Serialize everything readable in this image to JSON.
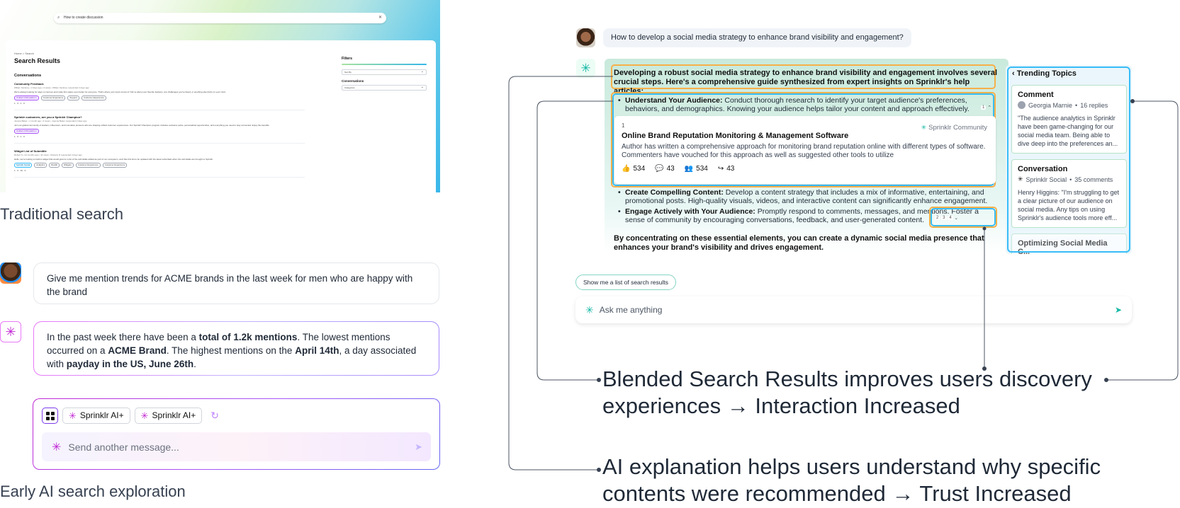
{
  "traditional": {
    "search_value": "How to create discussion",
    "breadcrumb": "Home > Search",
    "title": "Search Results",
    "section": "Conversations",
    "items": [
      {
        "title": "Community Feedback",
        "meta": "Willam Fackney • 2 days ago • 3 views • Willam Fackney responded 2 days ago",
        "desc": "We're always looking for ways to improve and make this space even better for everyone. That's where your input comes in! Tell us about your favorite features, any challenges you've faced, or anything else that's on your mind.",
        "tags": [
          "Unified CXM platform",
          "Customer Experience",
          "Support",
          "Customer Experience"
        ],
        "stats": "1 · 0 · 1 · 0"
      },
      {
        "title": "Sprinklr customers, are you a Sprinklr Champion?",
        "meta": "Joanna Baker • 1 month ago • 3 views • Joanna Baker responded 2 days ago",
        "desc": "Join our global community of leaders, influencers, and innovative pioneers who are shaping unified customer experiences. Our Sprinklr Champion program includes exclusive perks, personalized opportunities, and everything you need to stay connected. Enjoy the benefits.",
        "tags": [
          "Unified CXM platform"
        ],
        "stats": "1 · 0 · 1 · 0"
      },
      {
        "title": "Widget List of Submittle",
        "meta": "Robert S • 44 months ago • 44 views • Roberto R responded 3 days ago",
        "desc": "Hello, we're looking to build a widget that would grant to a list of the submittals added as part of our ecosystem, we'd like this list to be updated with the latest submittals when the submittals are brought to Sprinklr.",
        "tags": [
          "Sprinklr Social",
          "Analytics",
          "Reddit",
          "Widgets",
          "Customer Experience",
          "Customer Experience"
        ],
        "stats": "1 · 0 · 10 · 0"
      }
    ],
    "filters": {
      "title": "Filters",
      "select1": "Sort By",
      "title2": "Conversations",
      "select2": "Categories"
    },
    "caption": "Traditional search"
  },
  "early": {
    "user_message": "Give me mention trends for ACME brands in the last week for men who are happy with the brand",
    "ai_parts": {
      "p1": "In the past week there have been a ",
      "b1": "total of 1.2k mentions",
      "p2": ". The lowest mentions occurred on a ",
      "b2": "ACME Brand",
      "p3": ". The highest mentions on the ",
      "b3": "April 14th",
      "p4": ", a day associated with ",
      "b4": "payday in the US, June 26th",
      "p5": "."
    },
    "chips": [
      "Sprinklr AI+",
      "Sprinklr AI+"
    ],
    "input_placeholder": "Send another message...",
    "caption": "Early AI search exploration"
  },
  "blended": {
    "question": "How to develop a social media strategy to enhance brand visibility and engagement?",
    "intro": "Developing a robust social media strategy to enhance brand visibility and engagement involves several crucial steps. Here's a comprehensive guide synthesized from expert insights on Sprinklr's help articles:",
    "bullets": [
      {
        "bold": "Understand Your Audience:",
        "text": " Conduct thorough research to identify your target audience's preferences, behaviors, and demographics. Knowing your audience helps tailor your content and approach effectively."
      },
      {
        "bold": "Create Compelling Content:",
        "text": " Develop a content strategy that includes a mix of informative, entertaining, and promotional posts. High-quality visuals, videos, and interactive content can significantly enhance engagement."
      },
      {
        "bold": "Engage Actively with Your Audience:",
        "text": " Promptly respond to comments, messages, and mentions. Foster a sense of community by encouraging conversations, feedback, and user-generated content."
      }
    ],
    "bullet1_cite": "1",
    "bullet3_cites": [
      "2",
      "3",
      "4"
    ],
    "source": {
      "num": "1",
      "brand": "Sprinklr Community",
      "title": "Online Brand Reputation Monitoring & Management Software",
      "desc": "Author has written a comprehensive approach for monitoring brand reputation online with different types of software. Commenters have vouched for this approach as well as suggested other tools to utilize",
      "likes": "534",
      "comments": "43",
      "members": "534",
      "shares": "43"
    },
    "outro": "By concentrating on these essential elements, you can create a dynamic social media presence that enhances your brand's visibility and drives engagement.",
    "trending": {
      "title": "Trending Topics",
      "cards": [
        {
          "type": "Comment",
          "author": "Georgia Marnie",
          "count": "16 replies",
          "body": "\"The audience analytics in Sprinklr have been game-changing for our social media team. Being able to dive deep into the preferences an..."
        },
        {
          "type": "Conversation",
          "author": "Sprinklr Social",
          "count": "35 comments",
          "body": "Henry Higgins: \"I'm struggling to get a clear picture of our audience on social media. Any tips on using Sprinklr's audience tools more eff..."
        },
        {
          "type": "Optimizing Social Media C...",
          "author": "",
          "count": "",
          "body": ""
        }
      ]
    },
    "show_list_label": "Show me a list of search results",
    "ask_placeholder": "Ask me anything",
    "annotation1_line1": "Blended Search Results improves users discovery",
    "annotation1_line2": "experiences → Interaction Increased",
    "annotation2_line1": "AI explanation helps users understand why specific",
    "annotation2_line2": "contents were recommended → Trust Increased"
  },
  "colors": {
    "orange_highlight": "#f6b04a",
    "blue_highlight": "#38bdf8",
    "teal_accent": "#14b8a6",
    "purple_accent": "#c026d3"
  }
}
